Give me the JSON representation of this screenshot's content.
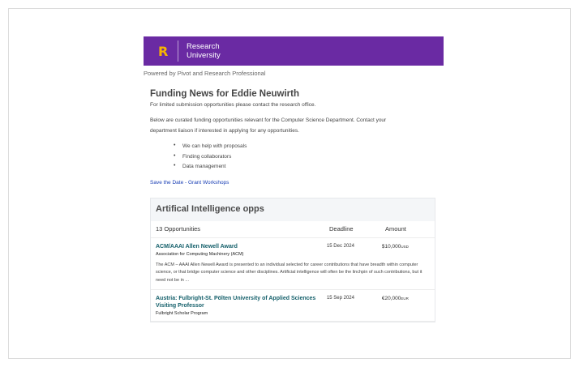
{
  "banner": {
    "logo_letter": "R",
    "logo_line1": "Research",
    "logo_line2": "University",
    "color": "#6a2aa3",
    "logo_color": "#f7b500"
  },
  "powered_by": "Powered by Pivot and Research Professional",
  "title": "Funding News for Eddie Neuwirth",
  "subtitle": "For limited submission opportunities please contact the research office.",
  "intro_line1": "Below are curated funding opportunities relevant for the Computer Science Department.  Contact your",
  "intro_line2": "department liaison if interested in applying for any opportunities.",
  "bullets": [
    "We can help with proposals",
    "Finding collaborators",
    "Data management"
  ],
  "link_text": "Save the Date - Grant Workshops",
  "section": {
    "title": "Artifical Intelligence opps",
    "columns": {
      "count": "13 Opportunities",
      "deadline": "Deadline",
      "amount": "Amount"
    },
    "opportunities": [
      {
        "title": "ACM/AAAI Allen Newell Award",
        "sponsor": "Association for Computing Machinery (ACM)",
        "deadline": "15 Dec 2024",
        "amount": "$10,000",
        "currency": "USD",
        "description": "The ACM – AAAI Allen Newell Award is presented to an individual selected for career contributions that have breadth within computer science, or that bridge computer science and other disciplines.  Artificial intelligence will often be the linchpin of such contributions, but it need not be in ..."
      },
      {
        "title": "Austria: Fulbright-St. Pölten University of Applied Sciences Visiting Professor",
        "sponsor": "Fulbright Scholar Program",
        "deadline": "15 Sep 2024",
        "amount": "€20,000",
        "currency": "EUR",
        "description": ""
      }
    ]
  }
}
